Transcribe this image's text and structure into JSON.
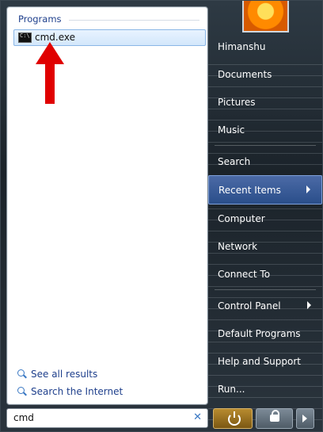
{
  "start_menu": {
    "programs_header": "Programs",
    "results": [
      {
        "label": "cmd.exe"
      }
    ],
    "see_all_results": "See all results",
    "search_the_internet": "Search the Internet",
    "search_box_value": "cmd"
  },
  "right_pane": {
    "items": [
      {
        "label": "Himanshu"
      },
      {
        "label": "Documents"
      },
      {
        "label": "Pictures"
      },
      {
        "label": "Music"
      },
      {
        "label": "Search"
      },
      {
        "label": "Recent Items",
        "has_submenu": true
      },
      {
        "label": "Computer"
      },
      {
        "label": "Network"
      },
      {
        "label": "Connect To"
      },
      {
        "label": "Control Panel",
        "has_submenu": true
      },
      {
        "label": "Default Programs"
      },
      {
        "label": "Help and Support"
      },
      {
        "label": "Run..."
      }
    ]
  },
  "icons": {
    "cmd": "cmd-icon",
    "search": "magnifier-icon",
    "power": "power-icon",
    "lock": "lock-icon",
    "more": "chevron-right-icon",
    "clear": "clear-icon",
    "avatar": "user-avatar",
    "annotation": "red-arrow-icon"
  },
  "colors": {
    "accent_blue": "#1e3f8c",
    "highlight_blue": "#2a4e8a",
    "annotation_red": "#e00000",
    "power_button": "#b88b2f"
  }
}
